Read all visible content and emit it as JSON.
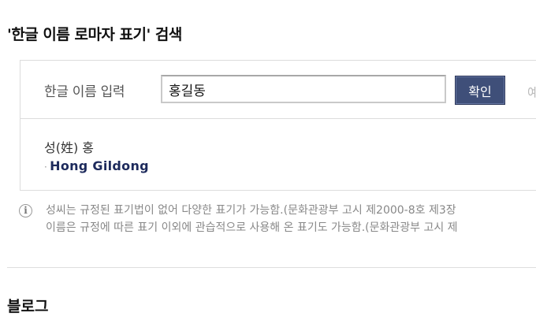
{
  "page_title": "'한글 이름 로마자 표기' 검색",
  "form": {
    "label": "한글 이름 입력",
    "input_value": "홍길동",
    "confirm_label": "확인",
    "cut_text": "예"
  },
  "result": {
    "surname": "성(姓) 홍",
    "romanized": "Hong Gildong"
  },
  "info": {
    "icon": "info-icon",
    "line1": "성씨는 규정된 표기법이 없어 다양한 표기가 가능함.(문화관광부 고시 제2000-8호 제3장",
    "line2": "이름은 규정에 따른 표기 이외에 관습적으로 사용해 온 표기도 가능함.(문화관광부 고시 제"
  },
  "next_section": {
    "heading": "블로그"
  },
  "colors": {
    "button": "#3f4f79",
    "romanized": "#1d2a5c"
  }
}
